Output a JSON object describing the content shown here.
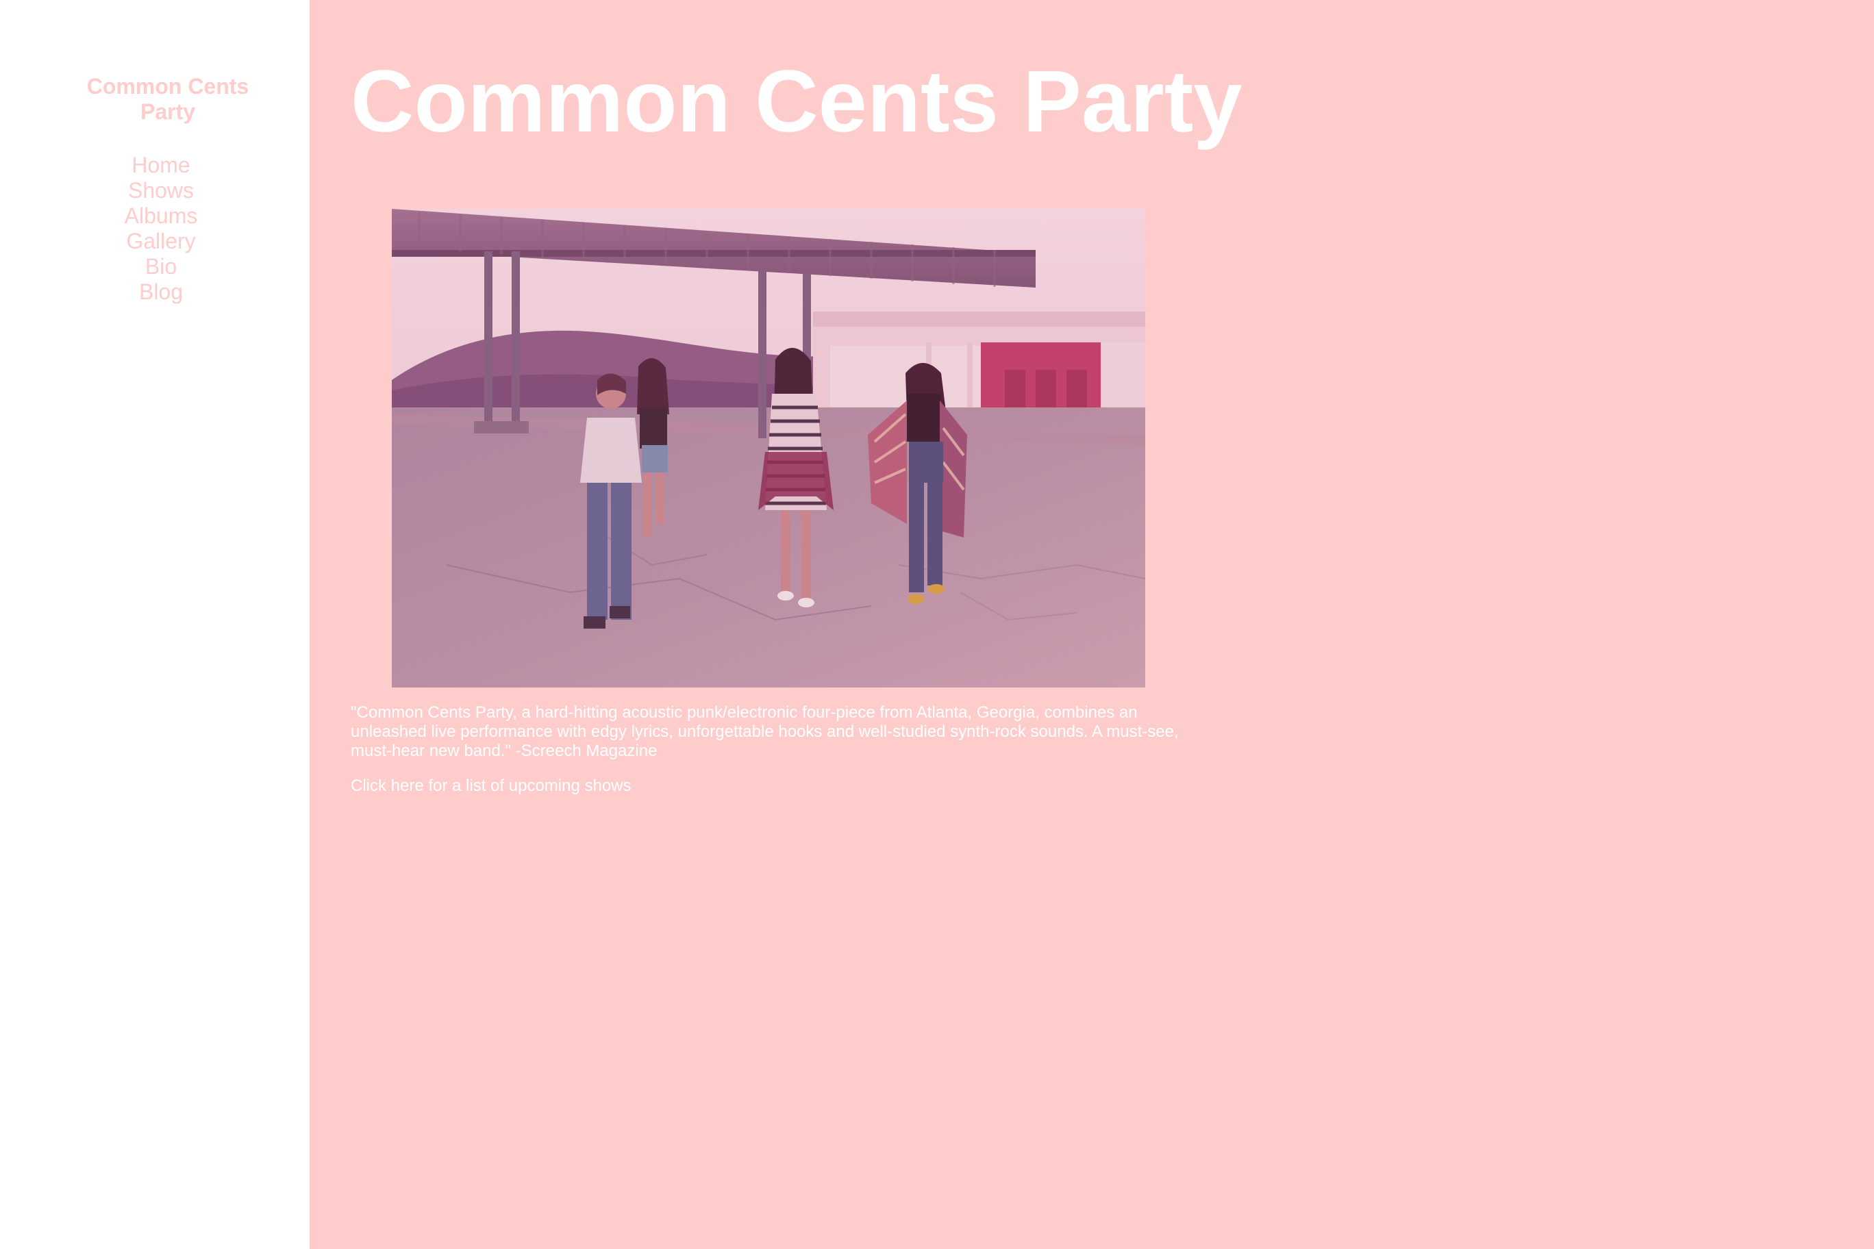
{
  "sidebar": {
    "site_name": "Common Cents Party",
    "nav": [
      {
        "label": "Home"
      },
      {
        "label": "Shows"
      },
      {
        "label": "Albums"
      },
      {
        "label": "Gallery"
      },
      {
        "label": "Bio"
      },
      {
        "label": "Blog"
      }
    ]
  },
  "main": {
    "title": "Common Cents Party",
    "quote": "\"Common Cents Party, a hard-hitting acoustic punk/electronic four-piece from Atlanta, Georgia, combines an unleashed live performance with edgy lyrics, unforgettable hooks and well-studied synth-rock sounds. A must-see, must-hear new band.\" -Screech Magazine",
    "shows_link": "Click here for a list of upcoming shows"
  },
  "colors": {
    "accent_pink": "#ffcccc",
    "text_white": "#ffffff"
  }
}
